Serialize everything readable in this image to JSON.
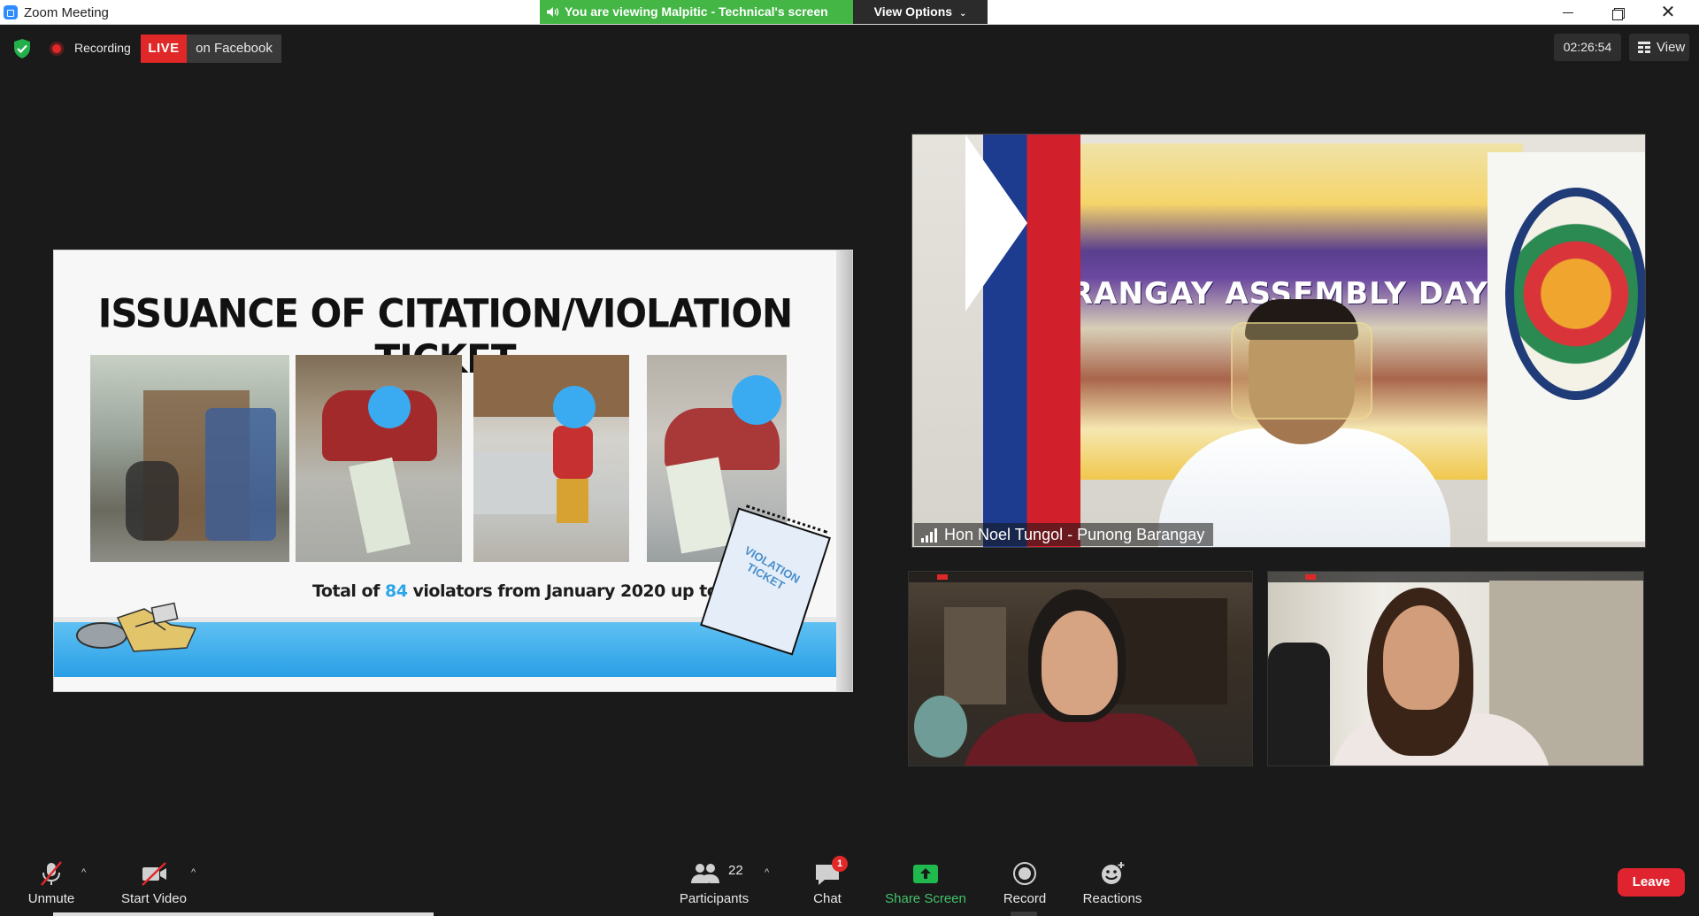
{
  "window": {
    "title": "Zoom Meeting",
    "viewing_banner": "You are viewing Malpitic - Technical's screen",
    "view_options": "View Options",
    "view_options_icon": "chevron-down-icon"
  },
  "topbar": {
    "recording_label": "Recording",
    "live_label": "LIVE",
    "live_platform": "on Facebook",
    "timer": "02:26:54",
    "view_label": "View"
  },
  "slide": {
    "title": "ISSUANCE OF CITATION/VIOLATION TICKET",
    "caption_prefix": "Total of ",
    "caption_number": "84",
    "caption_suffix": " violators from January 2020 up to present",
    "ticket_line1": "VIOLATION",
    "ticket_line2": "TICKET"
  },
  "speaker": {
    "name": "Hon Noel Tungol - Punong Barangay",
    "banner_text": "RANGAY ASSEMBLY DAY"
  },
  "toolbar": {
    "unmute": "Unmute",
    "start_video": "Start Video",
    "participants": "Participants",
    "participants_count": "22",
    "chat": "Chat",
    "chat_badge": "1",
    "share_screen": "Share Screen",
    "record": "Record",
    "reactions": "Reactions",
    "leave": "Leave"
  },
  "colors": {
    "accent_green": "#43b645",
    "live_red": "#e02828",
    "leave_red": "#e0242f",
    "slide_blue": "#2ea6e8",
    "background": "#1a1a1a"
  }
}
